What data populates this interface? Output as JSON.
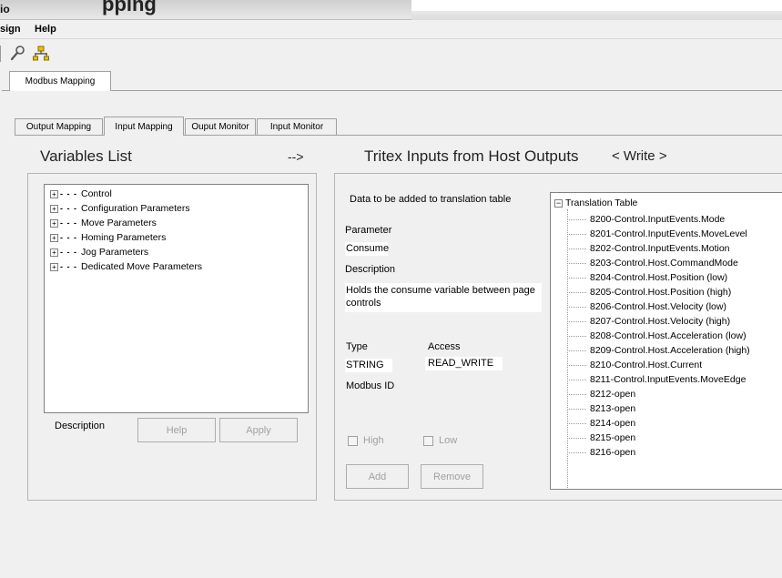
{
  "window": {
    "title_fragment": "io",
    "title_large": "pping"
  },
  "menu": [
    "sign",
    "Help"
  ],
  "toolbar": {
    "icons": [
      "wrench-icon",
      "network-icon"
    ]
  },
  "outer_tab": "Modbus Mapping",
  "inner_tabs": [
    "Output Mapping",
    "Input Mapping",
    "Ouput Monitor",
    "Input Monitor"
  ],
  "active_inner_tab": "Input Mapping",
  "headings": {
    "variables_list": "Variables List",
    "arrow": "-->",
    "tritex": "Tritex Inputs from Host Outputs",
    "mode": "< Write >"
  },
  "variables_tree": [
    "Control",
    "Configuration Parameters",
    "Move Parameters",
    "Homing Parameters",
    "Jog Parameters",
    "Dedicated Move Parameters"
  ],
  "left_footer": {
    "description_label": "Description",
    "help_button": "Help",
    "apply_button": "Apply"
  },
  "detail": {
    "header": "Data to be added to translation table",
    "parameter_label": "Parameter",
    "parameter_value": "Consume",
    "description_label": "Description",
    "description_value": "Holds the consume variable between page controls",
    "type_label": "Type",
    "type_value": "STRING",
    "access_label": "Access",
    "access_value": "READ_WRITE",
    "modbus_label": "Modbus ID",
    "high_label": "High",
    "low_label": "Low",
    "add_button": "Add",
    "remove_button": "Remove"
  },
  "translation_table": {
    "root": "Translation Table",
    "items": [
      "8200-Control.InputEvents.Mode",
      "8201-Control.InputEvents.MoveLevel",
      "8202-Control.InputEvents.Motion",
      "8203-Control.Host.CommandMode",
      "8204-Control.Host.Position (low)",
      "8205-Control.Host.Position (high)",
      "8206-Control.Host.Velocity (low)",
      "8207-Control.Host.Velocity (high)",
      "8208-Control.Host.Acceleration (low)",
      "8209-Control.Host.Acceleration (high)",
      "8210-Control.Host.Current",
      "8211-Control.InputEvents.MoveEdge",
      "8212-open",
      "8213-open",
      "8214-open",
      "8215-open",
      "8216-open"
    ]
  }
}
